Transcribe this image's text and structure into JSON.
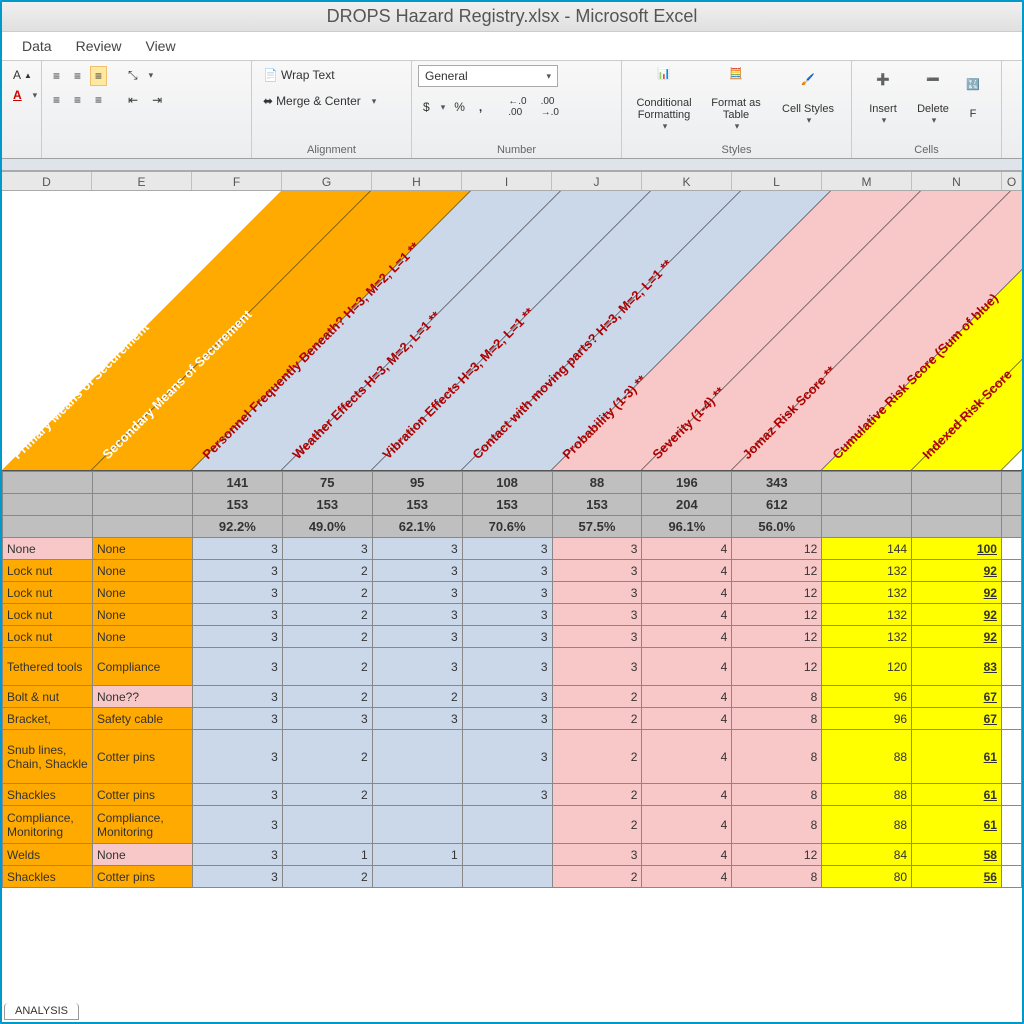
{
  "app_title": "DROPS Hazard Registry.xlsx  -  Microsoft Excel",
  "tabs": [
    "Data",
    "Review",
    "View"
  ],
  "ribbon": {
    "wrap": "Wrap Text",
    "merge": "Merge & Center",
    "alignment_label": "Alignment",
    "number_format": "General",
    "number_label": "Number",
    "cond_fmt": "Conditional Formatting",
    "fmt_table": "Format as Table",
    "cell_styles": "Cell Styles",
    "styles_label": "Styles",
    "insert": "Insert",
    "delete": "Delete",
    "format": "F",
    "cells_label": "Cells"
  },
  "col_letters": [
    "D",
    "E",
    "F",
    "G",
    "H",
    "I",
    "J",
    "K",
    "L",
    "M",
    "N",
    "O"
  ],
  "diag_headers": [
    {
      "label": "Primary Means of Securement*",
      "bg": "#ffaa00",
      "color": "#fff"
    },
    {
      "label": "Secondary Means of Securement",
      "bg": "#ffaa00",
      "color": "#fff"
    },
    {
      "label": "Personnel Frequently Beneath? H=3, M=2, L=1 **",
      "bg": "#cbd8ea",
      "color": "#b00000"
    },
    {
      "label": "Weather Effects H=3, M=2, L=1 **",
      "bg": "#cbd8ea",
      "color": "#b00000"
    },
    {
      "label": "Vibration Effects H=3, M=2, L=1 **",
      "bg": "#cbd8ea",
      "color": "#b00000"
    },
    {
      "label": "Contact with moving parts? H=3, M=2, L=1 **",
      "bg": "#cbd8ea",
      "color": "#b00000"
    },
    {
      "label": "Probability (1-3) **",
      "bg": "#f8c8c8",
      "color": "#b00000"
    },
    {
      "label": "Severity (1-4) **",
      "bg": "#f8c8c8",
      "color": "#b00000"
    },
    {
      "label": "Jomaz Risk Score **",
      "bg": "#f8c8c8",
      "color": "#b00000"
    },
    {
      "label": "Cumulative Risk Score (Sum of blue)",
      "bg": "#ffff00",
      "color": "#b00000"
    },
    {
      "label": "Indexed Risk Score",
      "bg": "#ffff00",
      "color": "#b00000"
    }
  ],
  "summary_rows": [
    [
      "",
      "",
      "141",
      "75",
      "95",
      "108",
      "88",
      "196",
      "343",
      "",
      ""
    ],
    [
      "",
      "",
      "153",
      "153",
      "153",
      "153",
      "153",
      "204",
      "612",
      "",
      ""
    ],
    [
      "",
      "",
      "92.2%",
      "49.0%",
      "62.1%",
      "70.6%",
      "57.5%",
      "96.1%",
      "56.0%",
      "",
      ""
    ]
  ],
  "data_rows": [
    {
      "d": "None",
      "e": "None",
      "v": [
        3,
        3,
        3,
        3,
        3,
        4,
        12
      ],
      "cum": 144,
      "idx": 100,
      "dcolor": "pink"
    },
    {
      "d": "Lock nut",
      "e": "None",
      "v": [
        3,
        2,
        3,
        3,
        3,
        4,
        12
      ],
      "cum": 132,
      "idx": 92,
      "dcolor": "orange"
    },
    {
      "d": "Lock nut",
      "e": "None",
      "v": [
        3,
        2,
        3,
        3,
        3,
        4,
        12
      ],
      "cum": 132,
      "idx": 92,
      "dcolor": "orange"
    },
    {
      "d": "Lock nut",
      "e": "None",
      "v": [
        3,
        2,
        3,
        3,
        3,
        4,
        12
      ],
      "cum": 132,
      "idx": 92,
      "dcolor": "orange"
    },
    {
      "d": "Lock nut",
      "e": "None",
      "v": [
        3,
        2,
        3,
        3,
        3,
        4,
        12
      ],
      "cum": 132,
      "idx": 92,
      "dcolor": "orange"
    },
    {
      "d": "Tethered tools",
      "e": "Compliance",
      "v": [
        3,
        2,
        3,
        3,
        3,
        4,
        12
      ],
      "cum": 120,
      "idx": 83,
      "dcolor": "orange",
      "tall": true
    },
    {
      "d": "Bolt & nut",
      "e": "None??",
      "v": [
        3,
        2,
        2,
        3,
        2,
        4,
        8
      ],
      "cum": 96,
      "idx": 67,
      "dcolor": "orange",
      "epink": true
    },
    {
      "d": "Bracket,",
      "e": "Safety cable",
      "v": [
        3,
        3,
        3,
        3,
        2,
        4,
        8
      ],
      "cum": 96,
      "idx": 67,
      "dcolor": "orange"
    },
    {
      "d": "Snub lines, Chain, Shackle",
      "e": "Cotter pins",
      "v": [
        3,
        2,
        "",
        3,
        2,
        4,
        8
      ],
      "cum": 88,
      "idx": 61,
      "dcolor": "orange",
      "tall3": true
    },
    {
      "d": "Shackles",
      "e": "Cotter pins",
      "v": [
        3,
        2,
        "",
        3,
        2,
        4,
        8
      ],
      "cum": 88,
      "idx": 61,
      "dcolor": "orange"
    },
    {
      "d": "Compliance, Monitoring",
      "e": "Compliance, Monitoring",
      "v": [
        3,
        "",
        "",
        "",
        2,
        4,
        8
      ],
      "cum": 88,
      "idx": 61,
      "dcolor": "orange",
      "tall": true
    },
    {
      "d": "Welds",
      "e": "None",
      "v": [
        3,
        1,
        1,
        "",
        3,
        4,
        12
      ],
      "cum": 84,
      "idx": 58,
      "dcolor": "orange",
      "epink": true
    },
    {
      "d": "Shackles",
      "e": "Cotter pins",
      "v": [
        3,
        2,
        "",
        "",
        2,
        4,
        8
      ],
      "cum": 80,
      "idx": 56,
      "dcolor": "orange"
    }
  ],
  "sheet_tab": "ANALYSIS"
}
